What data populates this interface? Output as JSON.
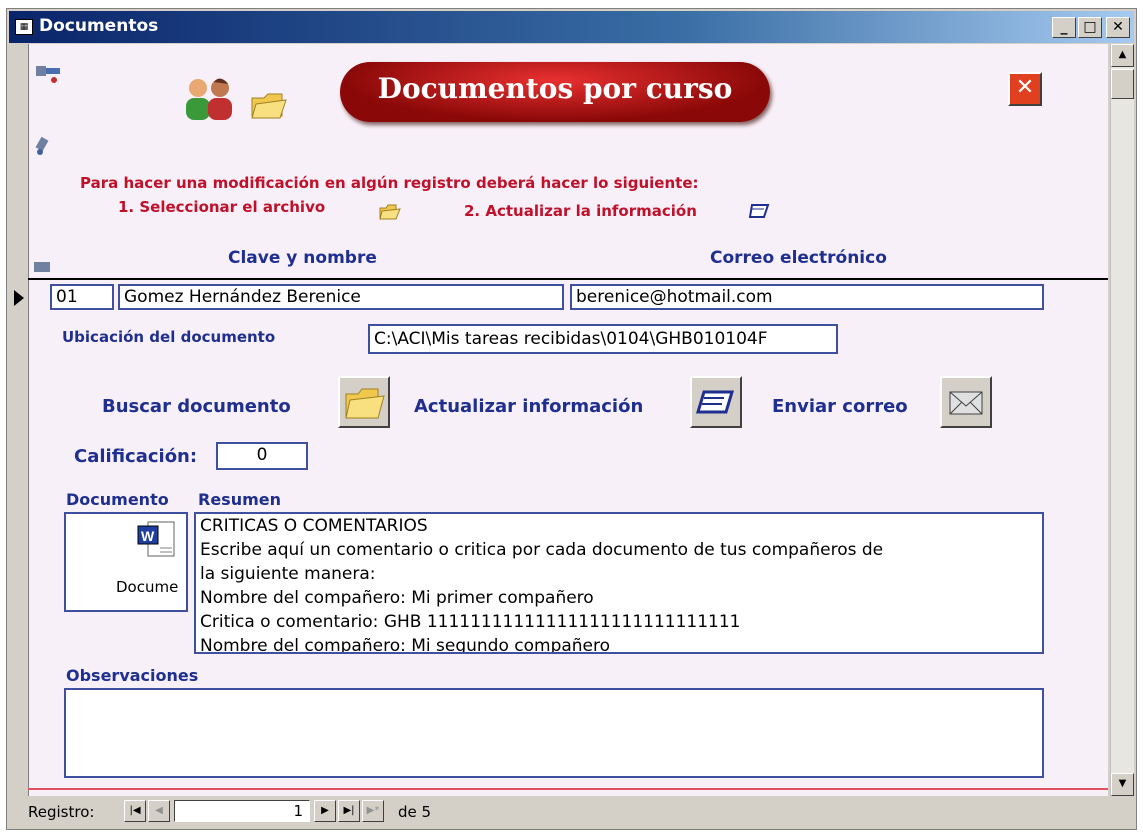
{
  "window": {
    "title": "Documentos",
    "min": "_",
    "max": "□",
    "close": "✕"
  },
  "header": {
    "banner": "Documentos por curso",
    "close_glyph": "✕"
  },
  "instructions": {
    "line1": "Para hacer una modificación en algún registro deberá hacer lo siguiente:",
    "step1": "1. Seleccionar el archivo",
    "step2": "2. Actualizar la información"
  },
  "columns": {
    "clave": "Clave y nombre",
    "correo": "Correo electrónico"
  },
  "record": {
    "clave": "01",
    "nombre": "Gomez Hernández Berenice",
    "correo": "berenice@hotmail.com",
    "ubicacion_label": "Ubicación del documento",
    "ubicacion": "C:\\ACI\\Mis tareas recibidas\\0104\\GHB010104F",
    "calificacion_label": "Calificación:",
    "calificacion": "0",
    "documento_label": "Documento",
    "documento_caption": "Docume",
    "resumen_label": "Resumen",
    "resumen_lines": [
      "CRITICAS O COMENTARIOS",
      "Escribe aquí un comentario o critica por cada documento de tus compañeros de",
      "la siguiente manera:",
      "Nombre del compañero: Mi primer compañero",
      "Critica o comentario: GHB 11111111111111111111111111111",
      "Nombre del compañero: Mi segundo compañero"
    ],
    "observaciones_label": "Observaciones",
    "observaciones": ""
  },
  "actions": {
    "buscar": "Buscar documento",
    "actualizar": "Actualizar información",
    "enviar": "Enviar correo"
  },
  "navigation": {
    "label": "Registro:",
    "current": "1",
    "of_label": "de 5"
  },
  "colors": {
    "label_blue": "#1f2f8f",
    "instruction_red": "#c0102a",
    "form_bg": "#f8f0f8"
  }
}
